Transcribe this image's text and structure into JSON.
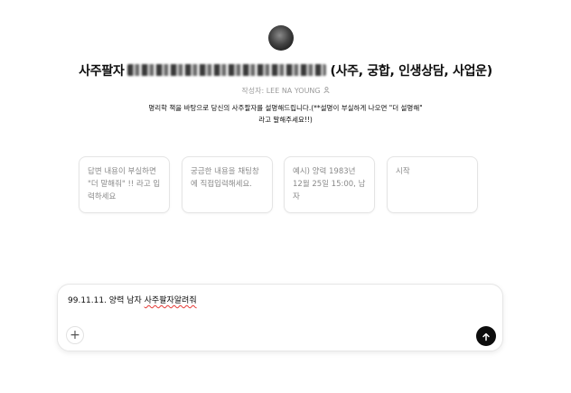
{
  "header": {
    "avatar_icon": "gpt-avatar-icon",
    "title_prefix": "사주팔자",
    "title_suffix": "(사주, 궁합, 인생상담, 사업운)",
    "author": "작성자: LEE NA YOUNG",
    "author_icon": "person-icon",
    "description": "명리학 책을 바탕으로 당신의 사주팔자를 설명해드립니다.(**설명이 부실하게 나오면 \"더 설명해\" 라고 말해주세요!!)"
  },
  "starters": [
    {
      "label": "답변 내용이 부실하면 \"더 말해줘\" !! 라고 입력하세요"
    },
    {
      "label": "궁금한 내용을 채팅창에 직접입력해세요."
    },
    {
      "label": "예시) 양력 1983년 12월 25일 15:00, 남자"
    },
    {
      "label": "시작"
    }
  ],
  "composer": {
    "input_prefix": "99.11.11. 양력 남자 ",
    "input_misspelled": "사주팔자알려줘",
    "attach_icon": "plus-icon",
    "send_icon": "arrow-up-icon"
  }
}
